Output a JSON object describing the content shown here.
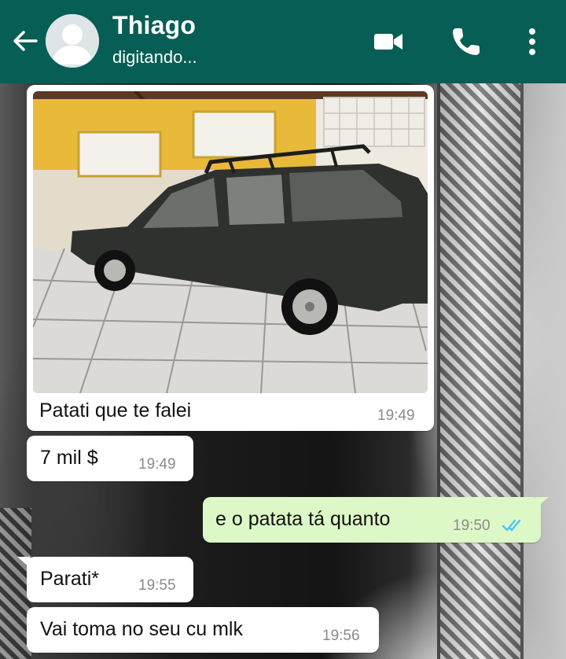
{
  "header": {
    "contact_name": "Thiago",
    "status": "digitando...",
    "back_icon": "arrow-left-icon",
    "video_icon": "videocam-icon",
    "call_icon": "phone-icon",
    "menu_icon": "more-vertical-icon",
    "background_color": "#075e54"
  },
  "messages": [
    {
      "direction": "in",
      "type": "image",
      "caption": "Patati que te falei",
      "time": "19:49"
    },
    {
      "direction": "in",
      "type": "text",
      "text": "7 mil $",
      "time": "19:49"
    },
    {
      "direction": "out",
      "type": "text",
      "text": "e o patata tá quanto",
      "time": "19:50",
      "status_icon": "double-check-read-icon"
    },
    {
      "direction": "in",
      "type": "text",
      "text": "Parati*",
      "time": "19:55"
    },
    {
      "direction": "in",
      "type": "text",
      "text": "Vai toma no seu cu mlk",
      "time": "19:56"
    }
  ],
  "colors": {
    "incoming_bubble": "#ffffff",
    "outgoing_bubble": "#dcf8c6",
    "read_ticks": "#4fc3f7"
  }
}
